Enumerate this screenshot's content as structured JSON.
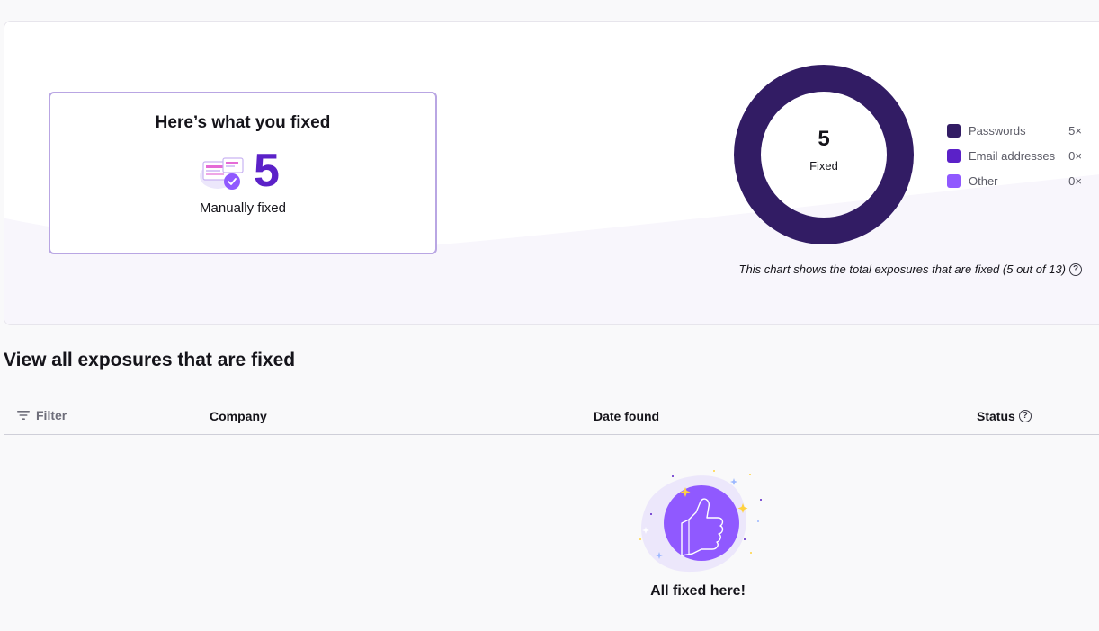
{
  "summary": {
    "card_title": "Here’s what you fixed",
    "fixed_count": "5",
    "fixed_label": "Manually fixed"
  },
  "chart_data": {
    "type": "pie",
    "center_value": "5",
    "center_label": "Fixed",
    "categories": [
      "Passwords",
      "Email addresses",
      "Other"
    ],
    "values": [
      5,
      0,
      0
    ],
    "value_labels": [
      "5×",
      "0×",
      "0×"
    ],
    "colors": [
      "#321c64",
      "#5b21c8",
      "#9059ff"
    ],
    "caption": "This chart shows the total exposures that are fixed (5 out of 13)"
  },
  "section": {
    "title": "View all exposures that are fixed"
  },
  "table": {
    "filter_label": "Filter",
    "columns": [
      "Company",
      "Date found",
      "Status"
    ]
  },
  "empty_state": {
    "message": "All fixed here!"
  },
  "colors": {
    "accent": "#5b21c8",
    "donut": "#321c64",
    "card_border": "#b9a6e3"
  }
}
